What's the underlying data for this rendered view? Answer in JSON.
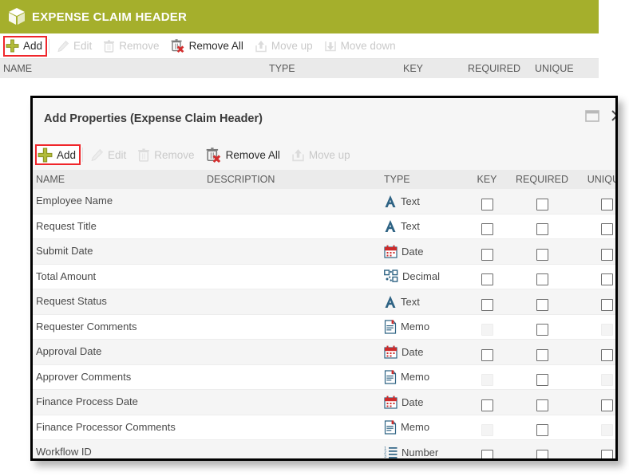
{
  "background_window": {
    "title": "EXPENSE CLAIM HEADER",
    "icon": "cube-icon",
    "accent_color": "#a5af2c",
    "toolbar": [
      {
        "label": "Add",
        "icon": "plus-icon",
        "enabled": true,
        "highlighted": true
      },
      {
        "label": "Edit",
        "icon": "pencil-icon",
        "enabled": false,
        "highlighted": false
      },
      {
        "label": "Remove",
        "icon": "trash-icon",
        "enabled": false,
        "highlighted": false
      },
      {
        "label": "Remove All",
        "icon": "trash-x-icon",
        "enabled": true,
        "highlighted": false
      },
      {
        "label": "Move up",
        "icon": "move-up-icon",
        "enabled": false,
        "highlighted": false
      },
      {
        "label": "Move down",
        "icon": "move-down-icon",
        "enabled": false,
        "highlighted": false
      }
    ],
    "columns": [
      "NAME",
      "TYPE",
      "KEY",
      "REQUIRED",
      "UNIQUE"
    ]
  },
  "dialog": {
    "title": "Add Properties (Expense Claim Header)",
    "window_buttons": [
      {
        "name": "maximize-button",
        "icon": "maximize-icon"
      },
      {
        "name": "close-button",
        "icon": "close-icon"
      }
    ],
    "toolbar": [
      {
        "label": "Add",
        "icon": "plus-icon",
        "enabled": true,
        "highlighted": true
      },
      {
        "label": "Edit",
        "icon": "pencil-icon",
        "enabled": false,
        "highlighted": false
      },
      {
        "label": "Remove",
        "icon": "trash-icon",
        "enabled": false,
        "highlighted": false
      },
      {
        "label": "Remove All",
        "icon": "trash-x-icon",
        "enabled": true,
        "highlighted": false
      },
      {
        "label": "Move up",
        "icon": "move-up-icon",
        "enabled": false,
        "highlighted": false
      }
    ],
    "columns": {
      "name": "NAME",
      "description": "DESCRIPTION",
      "type": "TYPE",
      "key": "KEY",
      "required": "REQUIRED",
      "unique": "UNIQUE"
    },
    "rows": [
      {
        "name": "Employee Name",
        "description": "",
        "type": "Text",
        "type_icon": "text-icon",
        "key": false,
        "key_enabled": true,
        "required": false,
        "required_enabled": true,
        "unique": false,
        "unique_enabled": true
      },
      {
        "name": "Request Title",
        "description": "",
        "type": "Text",
        "type_icon": "text-icon",
        "key": false,
        "key_enabled": true,
        "required": false,
        "required_enabled": true,
        "unique": false,
        "unique_enabled": true
      },
      {
        "name": "Submit Date",
        "description": "",
        "type": "Date",
        "type_icon": "date-icon",
        "key": false,
        "key_enabled": true,
        "required": false,
        "required_enabled": true,
        "unique": false,
        "unique_enabled": true
      },
      {
        "name": "Total Amount",
        "description": "",
        "type": "Decimal",
        "type_icon": "decimal-icon",
        "key": false,
        "key_enabled": true,
        "required": false,
        "required_enabled": true,
        "unique": false,
        "unique_enabled": true
      },
      {
        "name": "Request Status",
        "description": "",
        "type": "Text",
        "type_icon": "text-icon",
        "key": false,
        "key_enabled": true,
        "required": false,
        "required_enabled": true,
        "unique": false,
        "unique_enabled": true
      },
      {
        "name": "Requester Comments",
        "description": "",
        "type": "Memo",
        "type_icon": "memo-icon",
        "key": false,
        "key_enabled": false,
        "required": false,
        "required_enabled": true,
        "unique": false,
        "unique_enabled": false
      },
      {
        "name": "Approval Date",
        "description": "",
        "type": "Date",
        "type_icon": "date-icon",
        "key": false,
        "key_enabled": true,
        "required": false,
        "required_enabled": true,
        "unique": false,
        "unique_enabled": true
      },
      {
        "name": "Approver Comments",
        "description": "",
        "type": "Memo",
        "type_icon": "memo-icon",
        "key": false,
        "key_enabled": false,
        "required": false,
        "required_enabled": true,
        "unique": false,
        "unique_enabled": false
      },
      {
        "name": "Finance Process Date",
        "description": "",
        "type": "Date",
        "type_icon": "date-icon",
        "key": false,
        "key_enabled": true,
        "required": false,
        "required_enabled": true,
        "unique": false,
        "unique_enabled": true
      },
      {
        "name": "Finance Processor Comments",
        "description": "",
        "type": "Memo",
        "type_icon": "memo-icon",
        "key": false,
        "key_enabled": false,
        "required": false,
        "required_enabled": true,
        "unique": false,
        "unique_enabled": false
      },
      {
        "name": "Workflow ID",
        "description": "",
        "type": "Number",
        "type_icon": "number-icon",
        "key": false,
        "key_enabled": true,
        "required": false,
        "required_enabled": true,
        "unique": false,
        "unique_enabled": true
      }
    ]
  },
  "colors": {
    "header_green": "#a5af2c",
    "highlight_red": "#f0262b",
    "icon_blue": "#2e6384",
    "icon_red": "#d32f2f",
    "plus_olive": "#a5af2c"
  }
}
